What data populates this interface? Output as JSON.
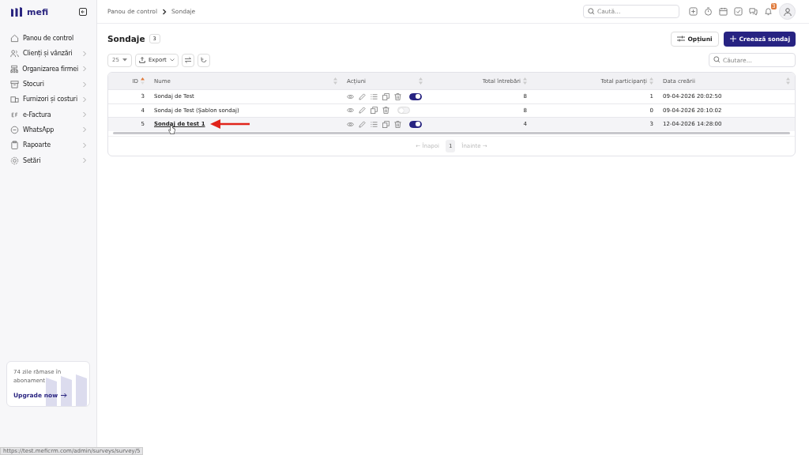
{
  "brand": {
    "name": "mefi"
  },
  "sidebar": {
    "items": [
      {
        "label": "Panou de control",
        "expandable": false
      },
      {
        "label": "Clienți și vânzări",
        "expandable": true
      },
      {
        "label": "Organizarea firmei",
        "expandable": true
      },
      {
        "label": "Stocuri",
        "expandable": true
      },
      {
        "label": "Furnizori și costuri",
        "expandable": true
      },
      {
        "label": "e-Factura",
        "expandable": true
      },
      {
        "label": "WhatsApp",
        "expandable": true
      },
      {
        "label": "Rapoarte",
        "expandable": true
      },
      {
        "label": "Setări",
        "expandable": true
      }
    ],
    "promo": {
      "text": "74 zile rămase în abonament",
      "link": "Upgrade now"
    }
  },
  "breadcrumb": [
    "Panou de control",
    "Sondaje"
  ],
  "topbar": {
    "search_placeholder": "Caută...",
    "notifications": "3"
  },
  "page": {
    "title": "Sondaje",
    "count": "3",
    "options_button": "Opțiuni",
    "create_button": "Creează sondaj"
  },
  "toolbar": {
    "page_size": "25",
    "export": "Export",
    "search_placeholder": "Căutare..."
  },
  "table": {
    "columns": [
      "ID",
      "Nume",
      "Acțiuni",
      "Total întrebări",
      "Total participanți",
      "Data creării"
    ],
    "rows": [
      {
        "id": "3",
        "name": "Sondaj de Test",
        "list_action": true,
        "on": true,
        "questions": "8",
        "participants": "1",
        "date": "09-04-2026 20:02:50",
        "hovered": false
      },
      {
        "id": "4",
        "name": "Sondaj de Test (Șablon sondaj)",
        "list_action": false,
        "on": false,
        "questions": "8",
        "participants": "0",
        "date": "09-04-2026 20:10:02",
        "hovered": false
      },
      {
        "id": "5",
        "name": "Sondaj de test 1",
        "list_action": true,
        "on": true,
        "questions": "4",
        "participants": "3",
        "date": "12-04-2026 14:28:00",
        "hovered": true
      }
    ]
  },
  "pagination": {
    "prev": "← Înapoi",
    "page": "1",
    "next": "Înainte →"
  },
  "status_bar": {
    "url": "https://test.meficrm.com/admin/surveys/survey/5"
  }
}
